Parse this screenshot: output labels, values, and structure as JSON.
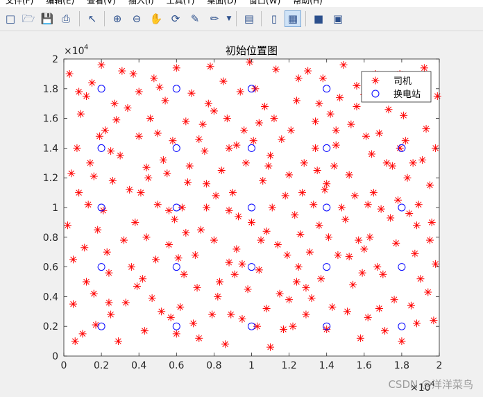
{
  "menu": [
    "文件(F)",
    "编辑(E)",
    "查看(V)",
    "插入(I)",
    "工具(T)",
    "桌面(D)",
    "窗口(W)",
    "帮助(H)"
  ],
  "toolbar": {
    "icons": [
      "new-file-icon",
      "open-folder-icon",
      "save-icon",
      "print-icon",
      "pointer-icon",
      "zoom-in-icon",
      "zoom-out-icon",
      "pan-hand-icon",
      "rotate-3d-icon",
      "data-cursor-icon",
      "brush-icon",
      "link-plot-icon",
      "colorbar-icon",
      "legend-icon",
      "hide-plot-tools-icon",
      "show-plot-tools-icon"
    ],
    "colors": {
      "accent": "#2b4f8c",
      "active_bg": "#cfe3f7"
    }
  },
  "watermark": "CSDN @洋洋菜鸟",
  "chart_data": {
    "type": "scatter",
    "title": "初始位置图",
    "xlabel": "",
    "ylabel": "",
    "xlim": [
      0,
      20000
    ],
    "ylim": [
      0,
      20000
    ],
    "x_ticks": [
      "0",
      "0.2",
      "0.4",
      "0.6",
      "0.8",
      "1",
      "1.2",
      "1.4",
      "1.6",
      "1.8",
      "2"
    ],
    "y_ticks": [
      "0",
      "0.2",
      "0.4",
      "0.6",
      "0.8",
      "1",
      "1.2",
      "1.4",
      "1.6",
      "1.8",
      "2"
    ],
    "x_exponent": "×10",
    "x_exponent_power": "4",
    "y_exponent": "×10",
    "y_exponent_power": "4",
    "grid": false,
    "legend_position": "top-right",
    "series": [
      {
        "name": "司机",
        "marker": "*",
        "color": "#ff0000",
        "points": [
          [
            1200,
            17500
          ],
          [
            3100,
            19200
          ],
          [
            4500,
            12000
          ],
          [
            6500,
            8300
          ],
          [
            8000,
            16500
          ],
          [
            9500,
            2500
          ],
          [
            11000,
            13500
          ],
          [
            12500,
            6000
          ],
          [
            13800,
            18700
          ],
          [
            15000,
            9200
          ],
          [
            16800,
            15000
          ],
          [
            18500,
            3400
          ],
          [
            19500,
            11500
          ],
          [
            500,
            6500
          ],
          [
            2500,
            2800
          ],
          [
            4200,
            5200
          ],
          [
            5800,
            14500
          ],
          [
            7200,
            1200
          ],
          [
            8800,
            9800
          ],
          [
            10200,
            18000
          ],
          [
            11800,
            10800
          ],
          [
            13200,
            3900
          ],
          [
            14500,
            14200
          ],
          [
            16000,
            7200
          ],
          [
            17500,
            12800
          ],
          [
            19000,
            18200
          ],
          [
            800,
            11000
          ],
          [
            2200,
            15200
          ],
          [
            3800,
            9000
          ],
          [
            5400,
            17200
          ],
          [
            7000,
            6800
          ],
          [
            8400,
            12500
          ],
          [
            9800,
            4500
          ],
          [
            11200,
            16000
          ],
          [
            12800,
            13000
          ],
          [
            14000,
            1800
          ],
          [
            15600,
            16800
          ],
          [
            17000,
            5500
          ],
          [
            18800,
            8800
          ],
          [
            1600,
            4200
          ],
          [
            3000,
            13500
          ],
          [
            4800,
            18700
          ],
          [
            6200,
            3300
          ],
          [
            7800,
            19500
          ],
          [
            9200,
            7200
          ],
          [
            10600,
            11800
          ],
          [
            12200,
            2000
          ],
          [
            13600,
            8800
          ],
          [
            15200,
            12200
          ],
          [
            16600,
            19000
          ],
          [
            18200,
            14500
          ],
          [
            19800,
            6200
          ],
          [
            300,
            19000
          ],
          [
            1800,
            8500
          ],
          [
            3400,
            16700
          ],
          [
            5000,
            10200
          ],
          [
            6600,
            11700
          ],
          [
            8200,
            4000
          ],
          [
            9600,
            15200
          ],
          [
            11000,
            600
          ],
          [
            12400,
            17200
          ],
          [
            13900,
            11200
          ],
          [
            15400,
            4800
          ],
          [
            16900,
            9900
          ],
          [
            18400,
            17800
          ],
          [
            1000,
            1500
          ],
          [
            2600,
            11800
          ],
          [
            4000,
            14800
          ],
          [
            5600,
            7500
          ],
          [
            7400,
            15600
          ],
          [
            8600,
            800
          ],
          [
            10000,
            9000
          ],
          [
            11600,
            14600
          ],
          [
            13000,
            19200
          ],
          [
            14600,
            6800
          ],
          [
            16200,
            2600
          ],
          [
            17800,
            10500
          ],
          [
            19300,
            15300
          ],
          [
            2000,
            19600
          ],
          [
            3600,
            6000
          ],
          [
            5200,
            3000
          ],
          [
            6800,
            17700
          ],
          [
            8800,
            14000
          ],
          [
            10400,
            5800
          ],
          [
            12000,
            12200
          ],
          [
            13400,
            15800
          ],
          [
            14800,
            10000
          ],
          [
            16400,
            13600
          ],
          [
            18000,
            1000
          ],
          [
            19600,
            9000
          ],
          [
            700,
            14000
          ],
          [
            2400,
            5600
          ],
          [
            4400,
            8000
          ],
          [
            6000,
            19400
          ],
          [
            7600,
            10000
          ],
          [
            9400,
            17800
          ],
          [
            10800,
            3200
          ],
          [
            12600,
            8200
          ],
          [
            14200,
            16300
          ],
          [
            15800,
            1200
          ],
          [
            17200,
            18600
          ],
          [
            18700,
            6900
          ],
          [
            1400,
            13000
          ],
          [
            2900,
            1000
          ],
          [
            4600,
            16000
          ],
          [
            6400,
            5500
          ],
          [
            8000,
            7800
          ],
          [
            9000,
            11000
          ],
          [
            11400,
            7500
          ],
          [
            12900,
            4600
          ],
          [
            14400,
            12800
          ],
          [
            16000,
            17600
          ],
          [
            17600,
            3800
          ],
          [
            19100,
            13200
          ],
          [
            500,
            3500
          ],
          [
            2100,
            9800
          ],
          [
            3700,
            19000
          ],
          [
            5300,
            13200
          ],
          [
            6900,
            2200
          ],
          [
            8500,
            18500
          ],
          [
            10100,
            14500
          ],
          [
            11700,
            1800
          ],
          [
            13300,
            10200
          ],
          [
            14900,
            19600
          ],
          [
            16500,
            11000
          ],
          [
            18100,
            16200
          ],
          [
            19700,
            2400
          ],
          [
            1100,
            7300
          ],
          [
            2700,
            17000
          ],
          [
            4300,
            1700
          ],
          [
            5900,
            9200
          ],
          [
            7500,
            13800
          ],
          [
            9100,
            5500
          ],
          [
            10700,
            16800
          ],
          [
            12300,
            9500
          ],
          [
            13700,
            5200
          ],
          [
            15300,
            15600
          ],
          [
            16700,
            6000
          ],
          [
            18300,
            12000
          ],
          [
            19900,
            17500
          ],
          [
            900,
            16300
          ],
          [
            2500,
            13800
          ],
          [
            4100,
            11000
          ],
          [
            5700,
            2600
          ],
          [
            7300,
            8500
          ],
          [
            8900,
            2800
          ],
          [
            10500,
            7800
          ],
          [
            12100,
            15200
          ],
          [
            13500,
            12500
          ],
          [
            15100,
            3000
          ],
          [
            16300,
            8000
          ],
          [
            17900,
            14000
          ],
          [
            19400,
            4300
          ],
          [
            1300,
            10200
          ],
          [
            3300,
            3600
          ],
          [
            4900,
            6500
          ],
          [
            6500,
            15800
          ],
          [
            8100,
            10800
          ],
          [
            9700,
            13000
          ],
          [
            11300,
            19300
          ],
          [
            12700,
            11000
          ],
          [
            14300,
            3300
          ],
          [
            15700,
            7800
          ],
          [
            17300,
            16600
          ],
          [
            18900,
            10200
          ],
          [
            200,
            8800
          ],
          [
            1700,
            2100
          ],
          [
            3500,
            11200
          ],
          [
            5100,
            18100
          ],
          [
            6700,
            12800
          ],
          [
            8300,
            5000
          ],
          [
            9900,
            19800
          ],
          [
            11500,
            4200
          ],
          [
            13100,
            7000
          ],
          [
            14700,
            17400
          ],
          [
            16100,
            14800
          ],
          [
            17700,
            7600
          ],
          [
            19200,
            19400
          ],
          [
            1500,
            18400
          ],
          [
            3900,
            4700
          ],
          [
            5500,
            12300
          ],
          [
            7100,
            4600
          ],
          [
            8700,
            16000
          ],
          [
            10300,
            2000
          ],
          [
            11900,
            6800
          ],
          [
            13400,
            14000
          ],
          [
            15500,
            10800
          ],
          [
            17100,
            1700
          ],
          [
            18600,
            13000
          ],
          [
            400,
            12300
          ],
          [
            2300,
            7000
          ],
          [
            4700,
            3900
          ],
          [
            6300,
            10000
          ],
          [
            7900,
            2800
          ],
          [
            9300,
            9400
          ],
          [
            10900,
            12800
          ],
          [
            12500,
            18700
          ],
          [
            14100,
            8000
          ],
          [
            15900,
            5600
          ],
          [
            17400,
            9300
          ],
          [
            19000,
            5200
          ],
          [
            600,
            1000
          ],
          [
            1900,
            14800
          ],
          [
            3200,
            7800
          ],
          [
            5000,
            15000
          ],
          [
            6100,
            6600
          ],
          [
            7700,
            17000
          ],
          [
            9500,
            6200
          ],
          [
            11100,
            10000
          ],
          [
            12900,
            2800
          ],
          [
            14500,
            15200
          ],
          [
            16200,
            10200
          ],
          [
            17900,
            19000
          ],
          [
            19500,
            7800
          ],
          [
            1200,
            5000
          ],
          [
            2800,
            15900
          ],
          [
            4400,
            12700
          ],
          [
            6000,
            1500
          ],
          [
            7600,
            11600
          ],
          [
            9200,
            14200
          ],
          [
            10800,
            8400
          ],
          [
            12400,
            5000
          ],
          [
            14000,
            11600
          ],
          [
            15600,
            18200
          ],
          [
            17200,
            13000
          ],
          [
            18800,
            2200
          ],
          [
            800,
            17800
          ],
          [
            2400,
            3600
          ],
          [
            4000,
            17800
          ],
          [
            5600,
            9800
          ],
          [
            7200,
            14600
          ],
          [
            8800,
            6300
          ],
          [
            10400,
            15700
          ],
          [
            12000,
            3800
          ],
          [
            13600,
            17000
          ],
          [
            15200,
            6700
          ],
          [
            16800,
            3200
          ],
          [
            18400,
            9600
          ],
          [
            19800,
            14000
          ],
          [
            1600,
            12100
          ]
        ]
      },
      {
        "name": "换电站",
        "marker": "o",
        "color": "#0000ff",
        "points": [
          [
            2000,
            2000
          ],
          [
            2000,
            6000
          ],
          [
            2000,
            10000
          ],
          [
            2000,
            14000
          ],
          [
            2000,
            18000
          ],
          [
            6000,
            2000
          ],
          [
            6000,
            6000
          ],
          [
            6000,
            10000
          ],
          [
            6000,
            14000
          ],
          [
            6000,
            18000
          ],
          [
            10000,
            2000
          ],
          [
            10000,
            6000
          ],
          [
            10000,
            10000
          ],
          [
            10000,
            14000
          ],
          [
            10000,
            18000
          ],
          [
            14000,
            2000
          ],
          [
            14000,
            6000
          ],
          [
            14000,
            10000
          ],
          [
            14000,
            14000
          ],
          [
            14000,
            18000
          ],
          [
            18000,
            2000
          ],
          [
            18000,
            6000
          ],
          [
            18000,
            10000
          ],
          [
            18000,
            14000
          ]
        ]
      }
    ]
  }
}
